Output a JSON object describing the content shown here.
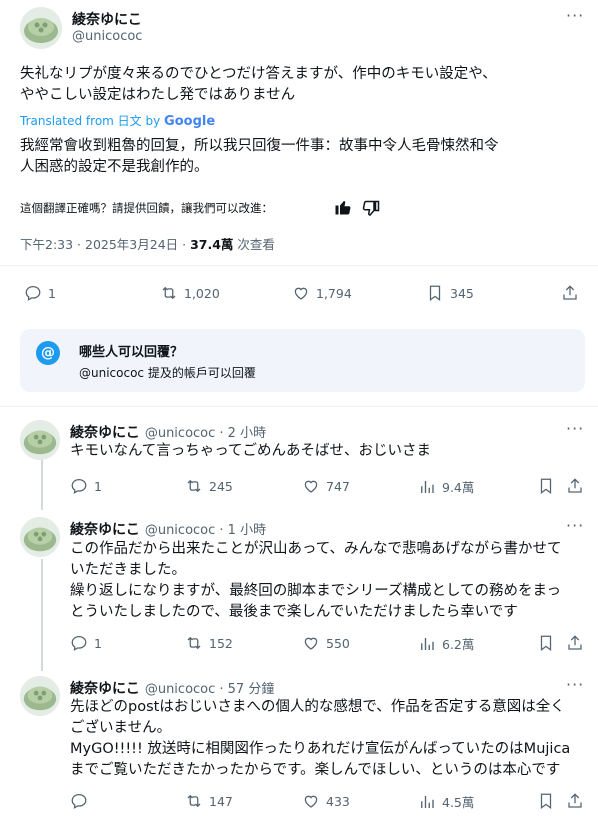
{
  "main_post": {
    "author_name": "綾奈ゆにこ",
    "author_handle": "@unicococ",
    "more_label": "···",
    "text_line1": "失礼なリプが度々来るのでひとつだけ答えますが、作中のキモい設定や、",
    "text_line2": "ややこしい設定はわたし発ではありません",
    "translated_label": "Translated from 日文 by",
    "translated_brand": "Google",
    "translation_line1": "我經常會收到粗魯的回复，所以我只回復一件事：故事中令人毛骨悚然和令",
    "translation_line2": "人困惑的設定不是我創作的。",
    "feedback_prompt": "這個翻譯正確嗎？請提供回饋，讓我們可以改進：",
    "timestamp": "下午2:33 · 2025年3月24日 · ",
    "views_count": "37.4萬",
    "views_label": " 次查看",
    "replies": "1",
    "reposts": "1,020",
    "likes": "1,794",
    "bookmarks": "345"
  },
  "reply_permission": {
    "icon": "@",
    "title": "哪些人可以回覆？",
    "subtitle": "@unicococ 提及的帳戶可以回覆"
  },
  "replies": [
    {
      "author_name": "綾奈ゆにこ",
      "meta": "@unicococ · 2 小時",
      "lines": [
        "キモいなんて言っちゃってごめんあそばせ、おじいさま"
      ],
      "replies": "1",
      "reposts": "245",
      "likes": "747",
      "views": "9.4萬"
    },
    {
      "author_name": "綾奈ゆにこ",
      "meta": "@unicococ · 1 小時",
      "lines": [
        "この作品だから出来たことが沢山あって、みんなで悲鳴あげながら書かせて",
        "いただきました。",
        "繰り返しになりますが、最終回の脚本までシリーズ構成としての務めをまっ",
        "とういたしましたので、最後まで楽しんでいただけましたら幸いです"
      ],
      "replies": "1",
      "reposts": "152",
      "likes": "550",
      "views": "6.2萬"
    },
    {
      "author_name": "綾奈ゆにこ",
      "meta": "@unicococ · 57 分鐘",
      "lines": [
        "先ほどのpostはおじいさまへの個人的な感想で、作品を否定する意図は全く",
        "ございません。",
        "MyGO!!!!! 放送時に相関図作ったりあれだけ宣伝がんばっていたのはMujica",
        "までご覧いただきたかったからです。楽しんでほしい、というのは本心です"
      ],
      "replies": "",
      "reposts": "147",
      "likes": "433",
      "views": "4.5萬"
    }
  ],
  "colors": {
    "accent": "#1d9bf0",
    "text": "#0f1419",
    "muted": "#536471"
  }
}
